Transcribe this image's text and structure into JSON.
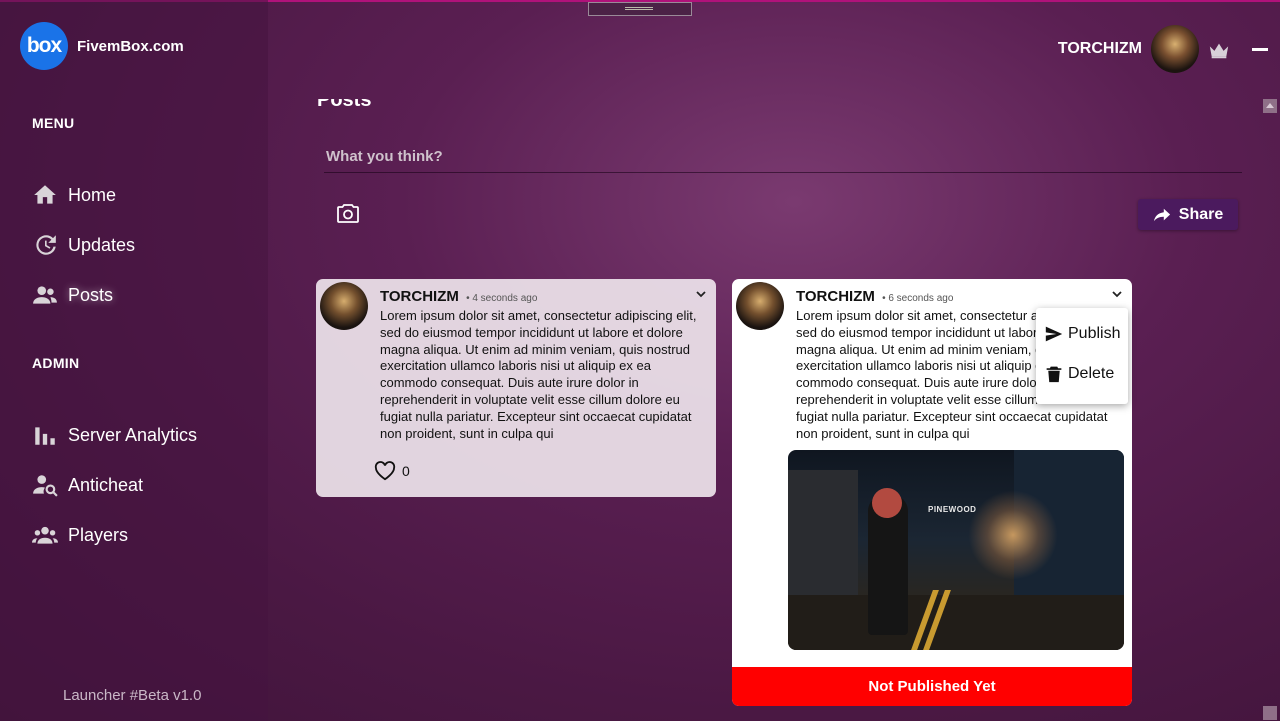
{
  "app": {
    "logo_mark": "box",
    "name": "FivemBox.com"
  },
  "sidebar": {
    "menu_title": "MENU",
    "menu_items": [
      {
        "label": "Home",
        "icon": "home-icon"
      },
      {
        "label": "Updates",
        "icon": "updates-icon"
      },
      {
        "label": "Posts",
        "icon": "posts-icon",
        "active": true
      }
    ],
    "admin_title": "ADMIN",
    "admin_items": [
      {
        "label": "Server Analytics",
        "icon": "bar-chart-icon"
      },
      {
        "label": "Anticheat",
        "icon": "anticheat-icon"
      },
      {
        "label": "Players",
        "icon": "players-icon"
      }
    ],
    "version": "Launcher #Beta v1.0"
  },
  "header": {
    "username": "TORCHIZM"
  },
  "main": {
    "title": "Posts",
    "composer": {
      "placeholder": "What you think?",
      "share_label": "Share"
    },
    "posts": [
      {
        "author": "TORCHIZM",
        "time": "• 4 seconds ago",
        "body": "Lorem ipsum dolor sit amet, consectetur adipiscing elit, sed do eiusmod tempor incididunt ut labore et dolore magna aliqua. Ut enim ad minim veniam, quis nostrud exercitation ullamco laboris nisi ut aliquip ex ea commodo consequat. Duis aute irure dolor in reprehenderit in voluptate velit esse cillum dolore eu fugiat nulla pariatur. Excepteur sint occaecat cupidatat non proident, sunt in culpa qui",
        "likes": "0"
      },
      {
        "author": "TORCHIZM",
        "time": "• 6 seconds ago",
        "body": "Lorem ipsum dolor sit amet, consectetur adipiscing elit, sed do eiusmod tempor incididunt ut labore et dolore magna aliqua. Ut enim ad minim veniam, quis nostrud exercitation ullamco laboris nisi ut aliquip ex ea commodo consequat. Duis aute irure dolor in reprehenderit in voluptate velit esse cillum dolore eu fugiat nulla pariatur. Excepteur sint occaecat cupidatat non proident, sunt in culpa qui",
        "image_sign": "PINEWOOD",
        "status": "Not Published Yet",
        "menu": {
          "publish": "Publish",
          "delete": "Delete"
        }
      }
    ]
  },
  "colors": {
    "accent": "#4b1a5e",
    "brand": "#1a73e8",
    "status_unpublished": "#ff0000"
  }
}
